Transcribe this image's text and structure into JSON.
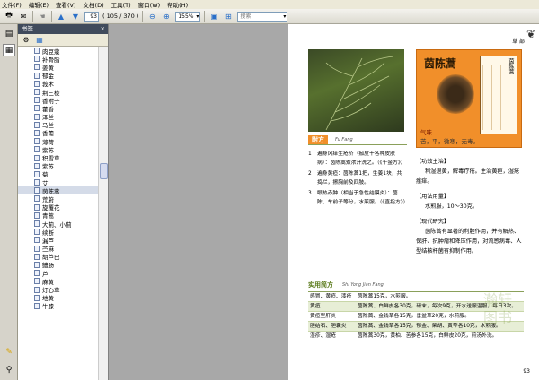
{
  "menu": [
    "文件(F)",
    "编辑(E)",
    "查看(V)",
    "文档(D)",
    "工具(T)",
    "窗口(W)",
    "帮助(H)"
  ],
  "toolbar": {
    "page_value": "93",
    "page_count": "( 105 / 370 )",
    "zoom": "155%",
    "search_placeholder": "搜索"
  },
  "panel": {
    "title": "书签",
    "close": "×"
  },
  "bookmarks": [
    "肉豆蔻",
    "补骨脂",
    "姜黄",
    "郁金",
    "莪术",
    "荆三棱",
    "香附子",
    "藿香",
    "泽兰",
    "马兰",
    "香薷",
    "薄荷",
    "紫苏",
    "积雪草",
    "紫苏",
    "菊",
    "艾",
    "茵陈蒿",
    "荒蔚",
    "旋覆花",
    "青蒿",
    "大蓟、小蓟",
    "续断",
    "漏芦",
    "苎麻",
    "胡芦巴",
    "鳢肠",
    "芦",
    "麻黄",
    "灯心草",
    "地黄",
    "牛膝"
  ],
  "selected_bookmark": 17,
  "page": {
    "header": "草 部",
    "plate_title": "茵陈蒿",
    "plate_card_title": "茵陈蒿",
    "plate_caption_1": "气味",
    "plate_caption_2": "苦，平，微寒，无毒。",
    "fufang_tag": "附方",
    "fufang_sub": "Fu Fang",
    "recipes": [
      {
        "n": "1",
        "t": "遍身风痒生疮疥（痂皮干各种皮肤病）：茵陈蒿煮浓汁洗之。（《千金方》）"
      },
      {
        "n": "2",
        "t": "遍身黄疸：茵陈蒿1把，生姜1块，共捣烂，擦胸前及四肢。"
      },
      {
        "n": "3",
        "t": "眼热赤肿（相当于急性结膜炎）：茵陈、车前子等分，水煎服。（《直指方》）"
      }
    ],
    "efficacy_h": "【功效主治】",
    "efficacy": "利湿退黄，解毒疗疮。主治黄疸，湿疮瘙痒。",
    "dosage_h": "【用法用量】",
    "dosage": "水煎服，10～30克。",
    "research_h": "【现代研究】",
    "research": "茵陈蒿有显著的利胆作用，并有解热、保肝、抗肿瘤和降压作用，对流感病毒、人型结核杆菌有抑制作用。",
    "table_tag": "实用简方",
    "table_sub": "Shi Yong Jian Fang",
    "table": [
      {
        "c1": "感冒、黄疸、漆疮",
        "c2": "茵陈蒿15克，水煎服。",
        "hl": false
      },
      {
        "c1": "黄疸",
        "c2": "茵陈蒿、白鲜皮各30克，研末，每次9克，开水送服温服，每日3次。",
        "hl": true
      },
      {
        "c1": "黄疸型肝炎",
        "c2": "茵陈蒿、金钱草各15克，垂盆草20克，水煎服。",
        "hl": false
      },
      {
        "c1": "胆结石、胆囊炎",
        "c2": "茵陈蒿、金钱草各15克，郁金、柴胡、黄芩各10克，水煎服。",
        "hl": true
      },
      {
        "c1": "湿疹、湿疮",
        "c2": "茵陈蒿30克，黄柏、苦参各15克，白鲜皮20克，煎汤外洗。",
        "hl": false
      }
    ],
    "watermark": "瀚轩图书",
    "page_number": "93"
  }
}
